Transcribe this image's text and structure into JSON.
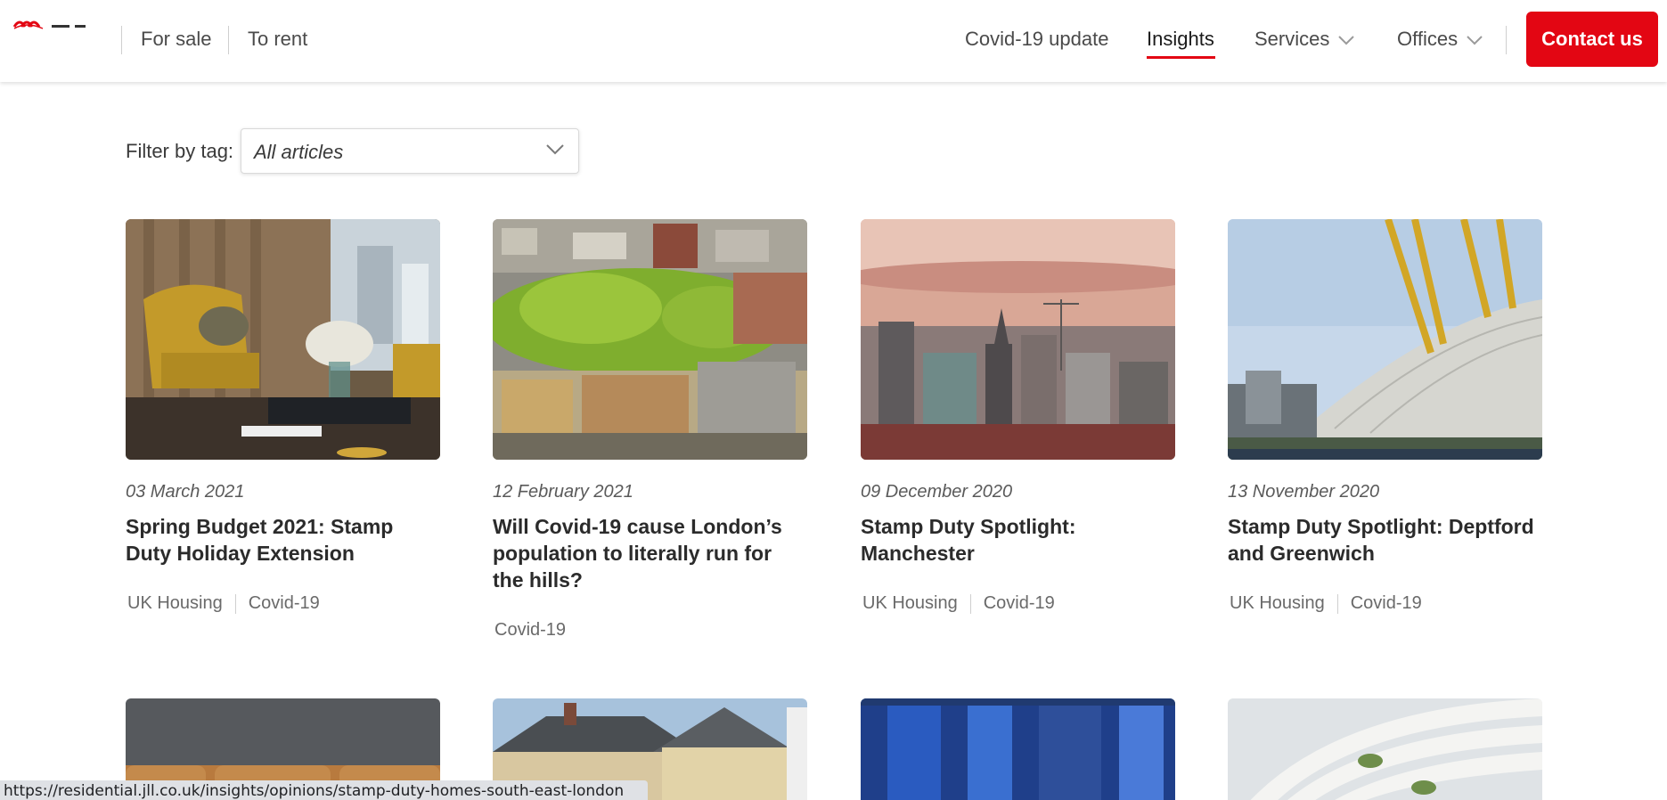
{
  "header": {
    "nav_left": [
      "For sale",
      "To rent"
    ],
    "nav_right": [
      {
        "label": "Covid-19 update",
        "dropdown": false,
        "active": false
      },
      {
        "label": "Insights",
        "dropdown": false,
        "active": true
      },
      {
        "label": "Services",
        "dropdown": true,
        "active": false
      },
      {
        "label": "Offices",
        "dropdown": true,
        "active": false
      }
    ],
    "contact_label": "Contact us",
    "accent_color": "#e30613"
  },
  "filter": {
    "label": "Filter by tag:",
    "value": "All articles"
  },
  "articles": [
    {
      "date": "03 March 2021",
      "title": "Spring Budget 2021: Stamp Duty Holiday Extension",
      "tags": [
        "UK Housing",
        "Covid-19"
      ],
      "image": "living-room-armchair"
    },
    {
      "date": "12 February 2021",
      "title": "Will Covid-19 cause London’s population to literally run for the hills?",
      "tags": [
        "Covid-19"
      ],
      "image": "london-rooftops-trees"
    },
    {
      "date": "09 December 2020",
      "title": "Stamp Duty Spotlight: Manchester",
      "tags": [
        "UK Housing",
        "Covid-19"
      ],
      "image": "manchester-skyline-sunset"
    },
    {
      "date": "13 November 2020",
      "title": "Stamp Duty Spotlight: Deptford and Greenwich",
      "tags": [
        "UK Housing",
        "Covid-19"
      ],
      "image": "o2-arena"
    },
    {
      "image": "leather-sofa"
    },
    {
      "image": "brick-houses"
    },
    {
      "image": "blue-glass-building"
    },
    {
      "image": "curved-white-tower"
    }
  ],
  "status_url": "https://residential.jll.co.uk/insights/opinions/stamp-duty-homes-south-east-london"
}
